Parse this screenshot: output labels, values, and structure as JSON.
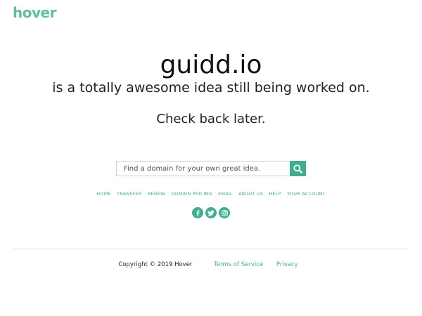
{
  "header": {
    "logo_text": "hover"
  },
  "main": {
    "domain": "guidd.io",
    "tagline": "is a totally awesome idea still being worked on.",
    "check_back": "Check back later."
  },
  "search": {
    "placeholder": "Find a domain for your own great idea.",
    "value": "",
    "button_icon": "search-icon"
  },
  "nav": {
    "items": [
      {
        "label": "HOME"
      },
      {
        "label": "TRANSFER"
      },
      {
        "label": "RENEW"
      },
      {
        "label": "DOMAIN PRICING"
      },
      {
        "label": "EMAIL"
      },
      {
        "label": "ABOUT US"
      },
      {
        "label": "HELP"
      },
      {
        "label": "YOUR ACCOUNT"
      }
    ]
  },
  "social": {
    "icons": [
      "facebook-icon",
      "twitter-icon",
      "instagram-icon"
    ]
  },
  "footer": {
    "copyright": "Copyright © 2019 Hover",
    "terms": "Terms of Service",
    "privacy": "Privacy"
  },
  "colors": {
    "accent": "#3fb08f",
    "logo_green": "#5fc09e",
    "logo_lime": "#8cc63f",
    "text": "#222222",
    "divider": "#dcdcdc"
  }
}
